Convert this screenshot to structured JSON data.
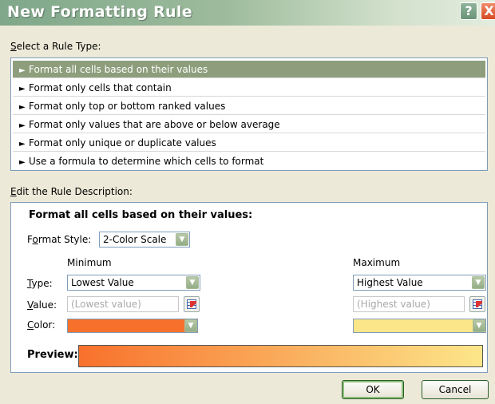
{
  "window": {
    "title": "New Formatting Rule",
    "help_glyph": "?",
    "close_glyph": "X"
  },
  "rule_type": {
    "label_first": "S",
    "label_rest": "elect a Rule Type:",
    "arrow": "►",
    "items": [
      "Format all cells based on their values",
      "Format only cells that contain",
      "Format only top or bottom ranked values",
      "Format only values that are above or below average",
      "Format only unique or duplicate values",
      "Use a formula to determine which cells to format"
    ],
    "selected_index": 0
  },
  "description": {
    "label_first": "E",
    "label_rest": "dit the Rule Description:",
    "heading": "Format all cells based on their values:",
    "format_style_label_a": "F",
    "format_style_label_u": "o",
    "format_style_label_b": "rmat Style:",
    "format_style_value": "2-Color Scale",
    "minimum_header": "Minimum",
    "maximum_header": "Maximum",
    "type_label_u": "T",
    "type_label_rest": "ype:",
    "value_label_u": "V",
    "value_label_rest": "alue:",
    "color_label_u": "C",
    "color_label_rest": "olor:",
    "min_type": "Lowest Value",
    "max_type": "Highest Value",
    "min_value_placeholder": "(Lowest value)",
    "max_value_placeholder": "(Highest value)",
    "min_color": "#F8712C",
    "max_color": "#FCE68A",
    "preview_label": "Preview:"
  },
  "buttons": {
    "ok": "OK",
    "cancel": "Cancel"
  },
  "icons": {
    "dropdown": "▼"
  }
}
